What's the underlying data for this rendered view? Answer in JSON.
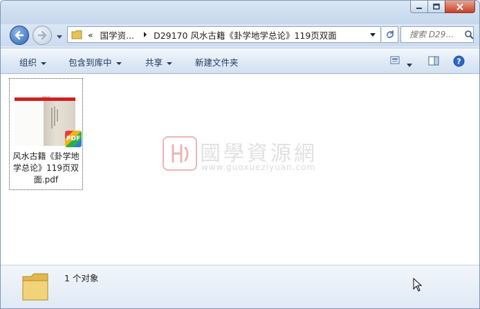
{
  "window": {
    "controls": {
      "minimize": "minimize",
      "maximize": "maximize",
      "close": "close"
    }
  },
  "navigation": {
    "breadcrumb": {
      "overflow": "«",
      "parent": "国学资...",
      "current": "D29170 风水古籍《卦学地学总论》119页双面"
    },
    "search": {
      "placeholder": "搜索 D29..."
    }
  },
  "toolbar": {
    "organize": "组织",
    "include_in_library": "包含到库中",
    "share": "共享",
    "new_folder": "新建文件夹"
  },
  "files": [
    {
      "name": "风水古籍《卦学地学总论》119页双面.pdf",
      "badge": "PDF",
      "thumb_tag": "PDF"
    }
  ],
  "watermark": {
    "title": "國學資源網",
    "url": "www.guoxueziyuan.com"
  },
  "status": {
    "count_text": "1 个对象"
  },
  "colors": {
    "accent": "#2d63b3",
    "close": "#c7402a",
    "pdf_red": "#d21e1e"
  },
  "icons": {
    "back": "back-arrow-icon",
    "forward": "forward-arrow-icon",
    "folder": "folder-icon",
    "refresh": "refresh-icon",
    "search": "search-icon",
    "view": "view-icon",
    "preview": "preview-pane-icon",
    "help": "help-icon"
  }
}
